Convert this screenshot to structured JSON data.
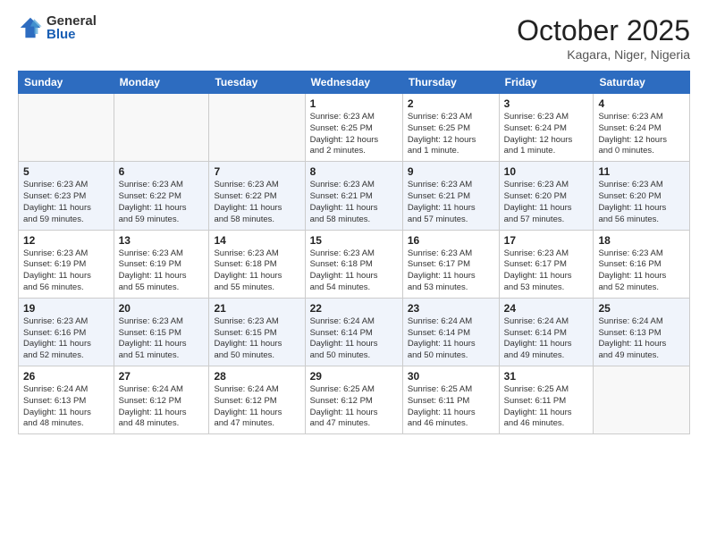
{
  "logo": {
    "general": "General",
    "blue": "Blue"
  },
  "header": {
    "month": "October 2025",
    "location": "Kagara, Niger, Nigeria"
  },
  "days_of_week": [
    "Sunday",
    "Monday",
    "Tuesday",
    "Wednesday",
    "Thursday",
    "Friday",
    "Saturday"
  ],
  "weeks": [
    [
      {
        "day": "",
        "info": ""
      },
      {
        "day": "",
        "info": ""
      },
      {
        "day": "",
        "info": ""
      },
      {
        "day": "1",
        "info": "Sunrise: 6:23 AM\nSunset: 6:25 PM\nDaylight: 12 hours\nand 2 minutes."
      },
      {
        "day": "2",
        "info": "Sunrise: 6:23 AM\nSunset: 6:25 PM\nDaylight: 12 hours\nand 1 minute."
      },
      {
        "day": "3",
        "info": "Sunrise: 6:23 AM\nSunset: 6:24 PM\nDaylight: 12 hours\nand 1 minute."
      },
      {
        "day": "4",
        "info": "Sunrise: 6:23 AM\nSunset: 6:24 PM\nDaylight: 12 hours\nand 0 minutes."
      }
    ],
    [
      {
        "day": "5",
        "info": "Sunrise: 6:23 AM\nSunset: 6:23 PM\nDaylight: 11 hours\nand 59 minutes."
      },
      {
        "day": "6",
        "info": "Sunrise: 6:23 AM\nSunset: 6:22 PM\nDaylight: 11 hours\nand 59 minutes."
      },
      {
        "day": "7",
        "info": "Sunrise: 6:23 AM\nSunset: 6:22 PM\nDaylight: 11 hours\nand 58 minutes."
      },
      {
        "day": "8",
        "info": "Sunrise: 6:23 AM\nSunset: 6:21 PM\nDaylight: 11 hours\nand 58 minutes."
      },
      {
        "day": "9",
        "info": "Sunrise: 6:23 AM\nSunset: 6:21 PM\nDaylight: 11 hours\nand 57 minutes."
      },
      {
        "day": "10",
        "info": "Sunrise: 6:23 AM\nSunset: 6:20 PM\nDaylight: 11 hours\nand 57 minutes."
      },
      {
        "day": "11",
        "info": "Sunrise: 6:23 AM\nSunset: 6:20 PM\nDaylight: 11 hours\nand 56 minutes."
      }
    ],
    [
      {
        "day": "12",
        "info": "Sunrise: 6:23 AM\nSunset: 6:19 PM\nDaylight: 11 hours\nand 56 minutes."
      },
      {
        "day": "13",
        "info": "Sunrise: 6:23 AM\nSunset: 6:19 PM\nDaylight: 11 hours\nand 55 minutes."
      },
      {
        "day": "14",
        "info": "Sunrise: 6:23 AM\nSunset: 6:18 PM\nDaylight: 11 hours\nand 55 minutes."
      },
      {
        "day": "15",
        "info": "Sunrise: 6:23 AM\nSunset: 6:18 PM\nDaylight: 11 hours\nand 54 minutes."
      },
      {
        "day": "16",
        "info": "Sunrise: 6:23 AM\nSunset: 6:17 PM\nDaylight: 11 hours\nand 53 minutes."
      },
      {
        "day": "17",
        "info": "Sunrise: 6:23 AM\nSunset: 6:17 PM\nDaylight: 11 hours\nand 53 minutes."
      },
      {
        "day": "18",
        "info": "Sunrise: 6:23 AM\nSunset: 6:16 PM\nDaylight: 11 hours\nand 52 minutes."
      }
    ],
    [
      {
        "day": "19",
        "info": "Sunrise: 6:23 AM\nSunset: 6:16 PM\nDaylight: 11 hours\nand 52 minutes."
      },
      {
        "day": "20",
        "info": "Sunrise: 6:23 AM\nSunset: 6:15 PM\nDaylight: 11 hours\nand 51 minutes."
      },
      {
        "day": "21",
        "info": "Sunrise: 6:23 AM\nSunset: 6:15 PM\nDaylight: 11 hours\nand 50 minutes."
      },
      {
        "day": "22",
        "info": "Sunrise: 6:24 AM\nSunset: 6:14 PM\nDaylight: 11 hours\nand 50 minutes."
      },
      {
        "day": "23",
        "info": "Sunrise: 6:24 AM\nSunset: 6:14 PM\nDaylight: 11 hours\nand 50 minutes."
      },
      {
        "day": "24",
        "info": "Sunrise: 6:24 AM\nSunset: 6:14 PM\nDaylight: 11 hours\nand 49 minutes."
      },
      {
        "day": "25",
        "info": "Sunrise: 6:24 AM\nSunset: 6:13 PM\nDaylight: 11 hours\nand 49 minutes."
      }
    ],
    [
      {
        "day": "26",
        "info": "Sunrise: 6:24 AM\nSunset: 6:13 PM\nDaylight: 11 hours\nand 48 minutes."
      },
      {
        "day": "27",
        "info": "Sunrise: 6:24 AM\nSunset: 6:12 PM\nDaylight: 11 hours\nand 48 minutes."
      },
      {
        "day": "28",
        "info": "Sunrise: 6:24 AM\nSunset: 6:12 PM\nDaylight: 11 hours\nand 47 minutes."
      },
      {
        "day": "29",
        "info": "Sunrise: 6:25 AM\nSunset: 6:12 PM\nDaylight: 11 hours\nand 47 minutes."
      },
      {
        "day": "30",
        "info": "Sunrise: 6:25 AM\nSunset: 6:11 PM\nDaylight: 11 hours\nand 46 minutes."
      },
      {
        "day": "31",
        "info": "Sunrise: 6:25 AM\nSunset: 6:11 PM\nDaylight: 11 hours\nand 46 minutes."
      },
      {
        "day": "",
        "info": ""
      }
    ]
  ]
}
